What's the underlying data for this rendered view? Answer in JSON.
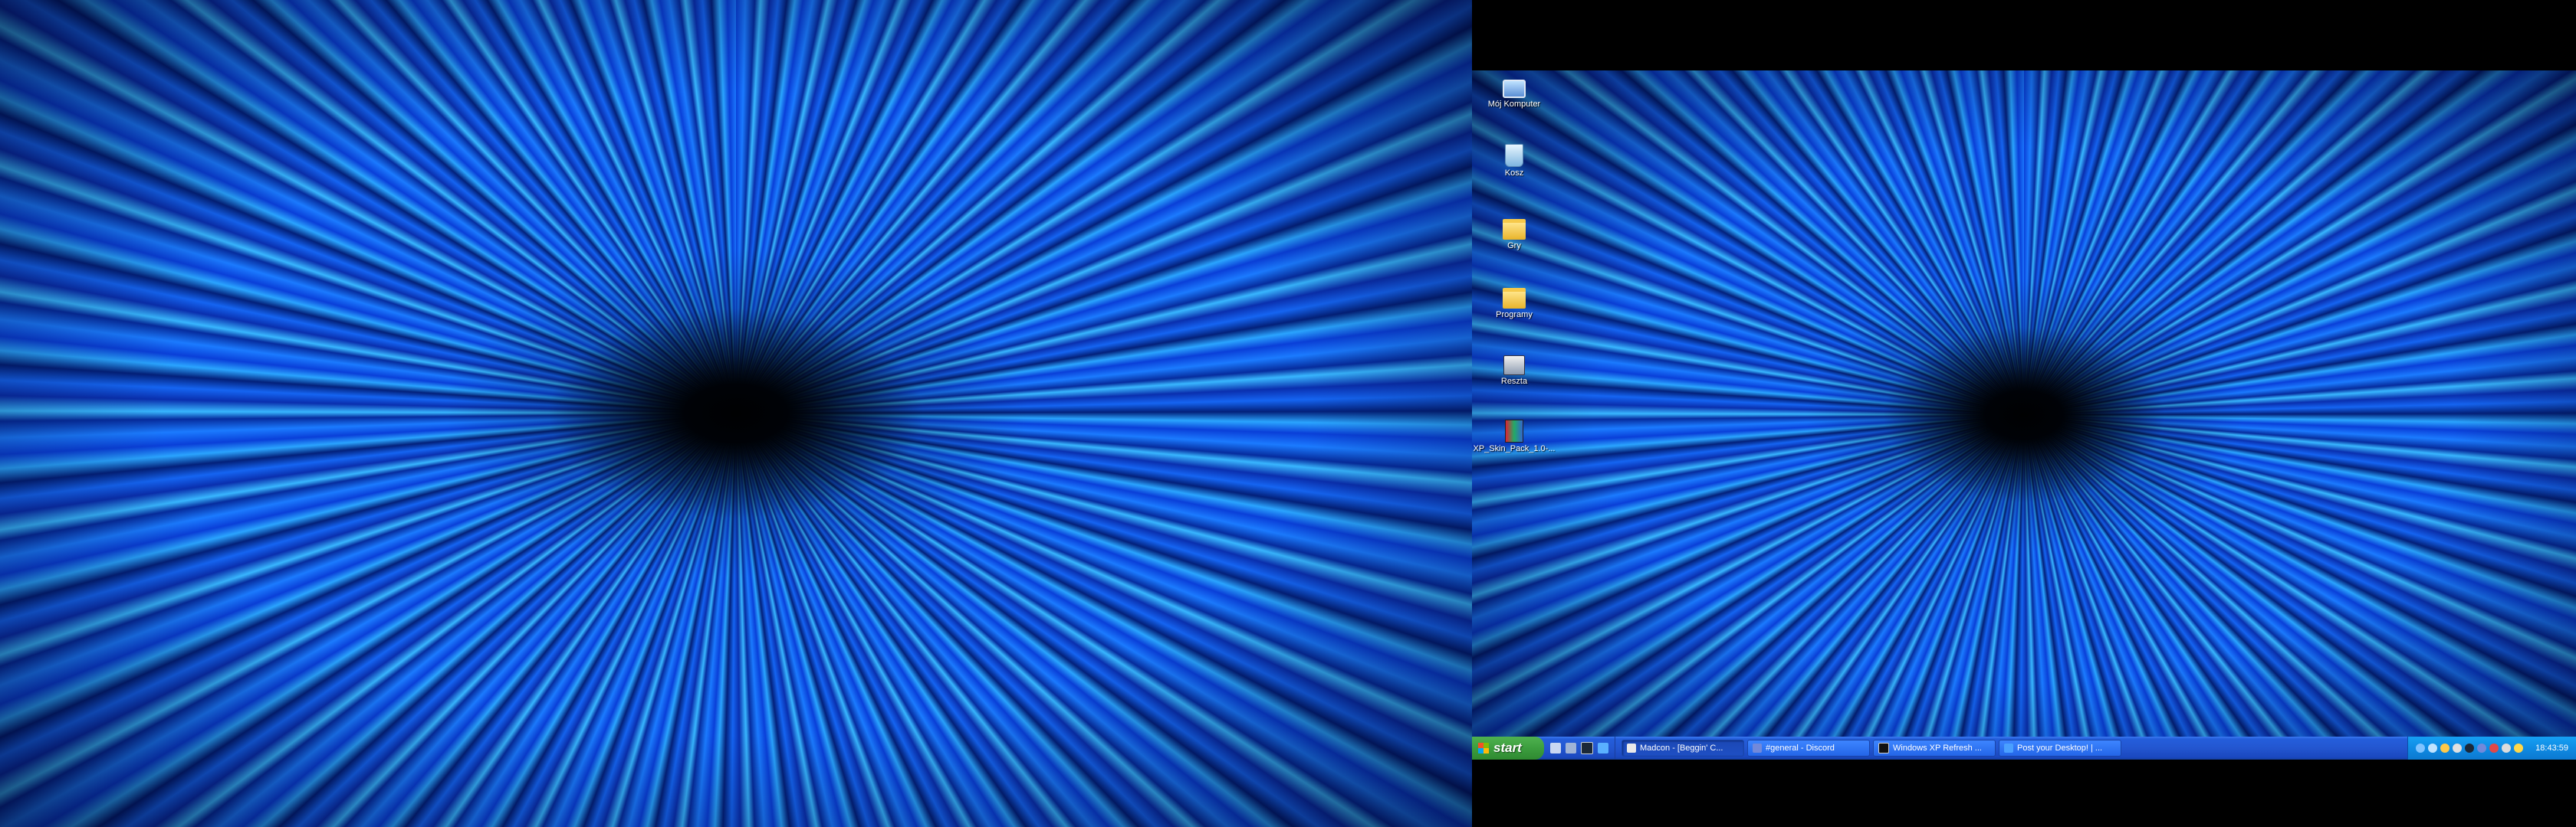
{
  "desktop_icons": [
    {
      "label": "Mój Komputer",
      "icon": "my-computer-icon"
    },
    {
      "label": "Kosz",
      "icon": "recycle-bin-icon"
    },
    {
      "label": "Gry",
      "icon": "folder-icon"
    },
    {
      "label": "Programy",
      "icon": "folder-icon"
    },
    {
      "label": "Reszta",
      "icon": "application-icon"
    },
    {
      "label": "XP_Skin_Pack_1.0-...",
      "icon": "installer-package-icon"
    }
  ],
  "taskbar": {
    "start_label": "start",
    "quick_launch": [
      "show-desktop-icon",
      "media-player-icon",
      "steam-icon",
      "browser-icon"
    ],
    "tasks": [
      {
        "label": "Madcon - [Beggin' C...",
        "icon": "media-app-icon",
        "active": true
      },
      {
        "label": "#general - Discord",
        "icon": "discord-icon",
        "active": false
      },
      {
        "label": "Windows XP Refresh ...",
        "icon": "terminal-icon",
        "active": false
      },
      {
        "label": "Post your Desktop! | ...",
        "icon": "browser-page-icon",
        "active": false
      }
    ],
    "tray_icons": [
      "network-icon",
      "internet-icon",
      "chat-icon",
      "volume-icon",
      "steam-tray-icon",
      "discord-tray-icon",
      "security-icon",
      "usb-icon",
      "update-icon"
    ],
    "clock": "18:43:59"
  },
  "colors": {
    "taskbar_blue": "#245edb",
    "start_green": "#3c9e3e",
    "tray_blue": "#0f8be3"
  }
}
